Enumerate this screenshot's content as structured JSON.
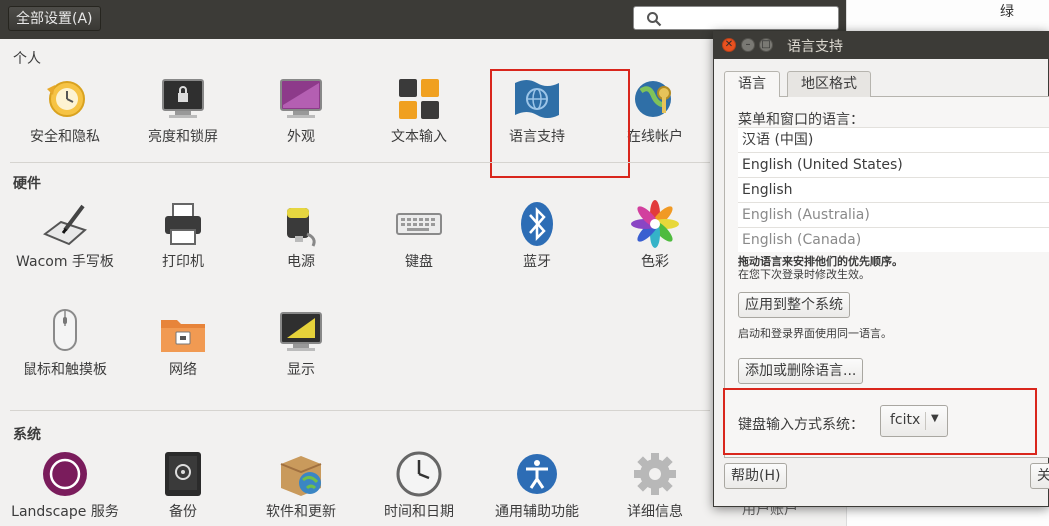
{
  "topbar": {
    "all_settings_label": "全部设置(A)",
    "search_icon": "search-icon"
  },
  "right_strip": {
    "top_text": "绿",
    "bottom_text": "用户账户"
  },
  "sections": {
    "personal": {
      "title": "个人",
      "items": [
        {
          "label": "安全和隐私",
          "icon": "security-clock-icon"
        },
        {
          "label": "亮度和锁屏",
          "icon": "monitor-lock-icon"
        },
        {
          "label": "外观",
          "icon": "monitor-appearance-icon"
        },
        {
          "label": "文本输入",
          "icon": "keyboard-keys-icon"
        },
        {
          "label": "语言支持",
          "icon": "flag-globe-icon"
        },
        {
          "label": "在线帐户",
          "icon": "online-accounts-icon"
        }
      ]
    },
    "hardware": {
      "title": "硬件",
      "items": [
        {
          "label": "Wacom 手写板",
          "icon": "wacom-tablet-icon"
        },
        {
          "label": "打印机",
          "icon": "printer-icon"
        },
        {
          "label": "电源",
          "icon": "battery-icon"
        },
        {
          "label": "键盘",
          "icon": "keyboard-icon"
        },
        {
          "label": "蓝牙",
          "icon": "bluetooth-icon"
        },
        {
          "label": "色彩",
          "icon": "color-icon"
        },
        {
          "label": "鼠标和触摸板",
          "icon": "mouse-icon"
        },
        {
          "label": "网络",
          "icon": "network-folder-icon"
        },
        {
          "label": "显示",
          "icon": "display-icon"
        }
      ]
    },
    "system": {
      "title": "系统",
      "items": [
        {
          "label": "Landscape 服务",
          "icon": "landscape-icon"
        },
        {
          "label": "备份",
          "icon": "backup-safe-icon"
        },
        {
          "label": "软件和更新",
          "icon": "software-update-icon"
        },
        {
          "label": "时间和日期",
          "icon": "clock-icon"
        },
        {
          "label": "通用辅助功能",
          "icon": "accessibility-icon"
        },
        {
          "label": "详细信息",
          "icon": "gear-icon"
        }
      ]
    }
  },
  "dialog": {
    "title": "语言支持",
    "tabs": [
      {
        "label": "语言",
        "active": true
      },
      {
        "label": "地区格式",
        "active": false
      }
    ],
    "menu_label": "菜单和窗口的语言：",
    "languages": [
      {
        "name": "汉语 (中国)",
        "enabled": true
      },
      {
        "name": "English (United States)",
        "enabled": true
      },
      {
        "name": "English",
        "enabled": true
      },
      {
        "name": "English (Australia)",
        "enabled": false
      },
      {
        "name": "English (Canada)",
        "enabled": false
      }
    ],
    "drag_hint": "拖动语言来安排他们的优先顺序。",
    "drag_hint2": "在您下次登录时修改生效。",
    "apply_button": "应用到整个系统",
    "apply_note": "启动和登录界面使用同一语言。",
    "add_remove_button": "添加或删除语言...",
    "keyboard_input_label": "键盘输入方式系统：",
    "keyboard_input_value": "fcitx",
    "help_button": "帮助(H)",
    "close_button": "关"
  },
  "colors": {
    "highlight": "#d9261c",
    "titlebar": "#3c3b37",
    "close_button": "#e9511f"
  }
}
